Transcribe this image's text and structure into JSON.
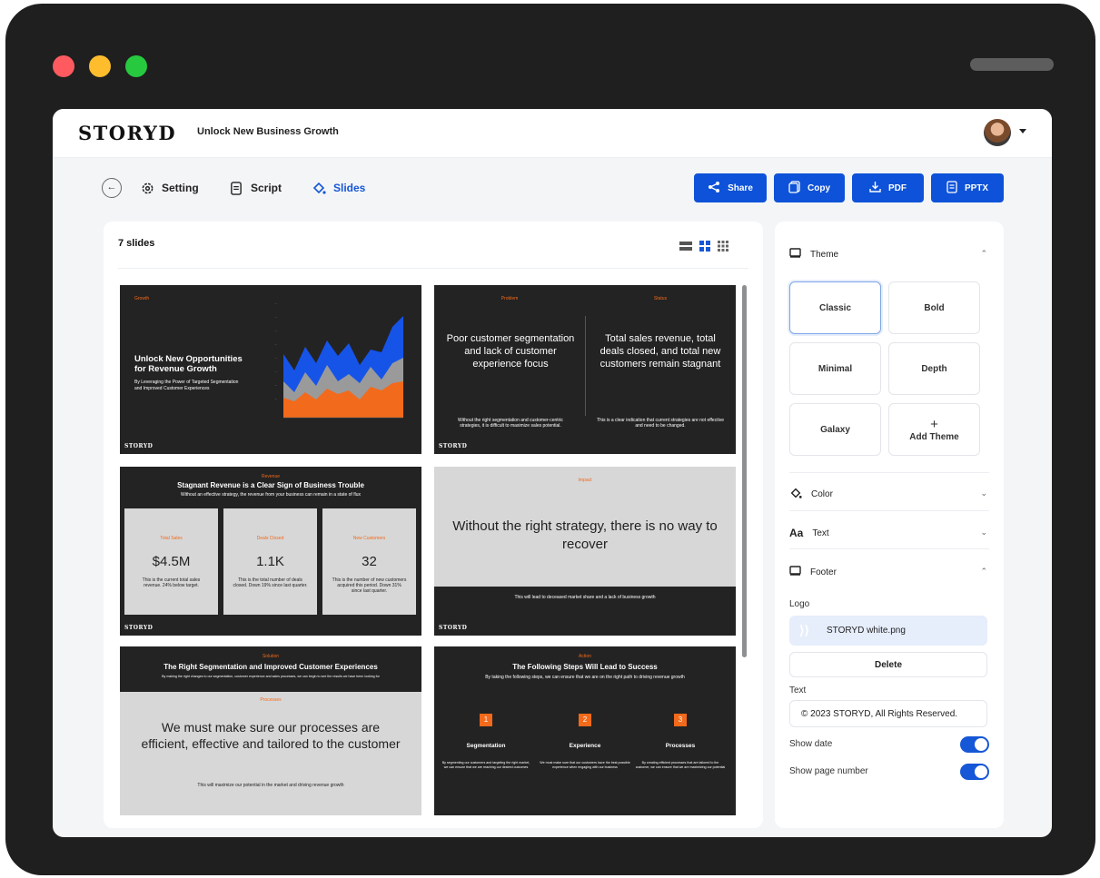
{
  "window": {
    "dot_colors": [
      "#ff5a5f",
      "#ffbd2e",
      "#27c93f"
    ]
  },
  "header": {
    "logo": "STORYD",
    "doc_title": "Unlock New Business Growth"
  },
  "nav": {
    "setting": "Setting",
    "script": "Script",
    "slides": "Slides"
  },
  "actions": {
    "share": "Share",
    "copy": "Copy",
    "pdf": "PDF",
    "pptx": "PPTX"
  },
  "slides_panel": {
    "count_label": "7 slides"
  },
  "slides": {
    "s1": {
      "tag": "Growth",
      "title": "Unlock New Opportunities for Revenue Growth",
      "subtitle": "By Leveraging the Power of Targeted Segmentation and Improved Customer Experiences",
      "footer_logo": "STORYD"
    },
    "s2": {
      "tag_left": "Problem",
      "tag_right": "Status",
      "left_title": "Poor customer segmentation and lack of customer experience focus",
      "right_title": "Total sales revenue, total deals closed, and total new customers remain stagnant",
      "left_text": "Without the right segmentation and customer-centric strategies, it is difficult to maximize sales potential.",
      "right_text": "This is a clear indication that current strategies are not effective and need to be changed.",
      "footer_logo": "STORYD"
    },
    "s3": {
      "tag": "Revenue",
      "title": "Stagnant Revenue is a Clear Sign of Business Trouble",
      "subtitle": "Without an effective strategy, the revenue from your business can remain in a state of flux",
      "footer_logo": "STORYD",
      "cards": [
        {
          "label": "Total Sales",
          "value": "$4.5M",
          "text": "This is the current total sales revenue. 24% below target."
        },
        {
          "label": "Deals Closed",
          "value": "1.1K",
          "text": "This is the total number of deals closed. Down 19% since last quarter."
        },
        {
          "label": "New Customers",
          "value": "32",
          "text": "This is the number of new customers acquired this period. Down 31% since last quarter."
        }
      ]
    },
    "s4": {
      "tag": "Impact",
      "title": "Without the right strategy, there is no way to recover",
      "footer_text": "This will lead to deceased market share and a lack of business growth",
      "footer_logo": "STORYD"
    },
    "s5": {
      "tag": "Solution",
      "title": "The Right Segmentation and Improved Customer Experiences",
      "subtitle": "By making the right changes to our segmentation, customer experience and sales processes, we can begin to see the results we have been looking for",
      "tag2": "Processes",
      "body": "We must make sure our processes are efficient, effective and tailored to the customer",
      "footer_text": "This will maximize our potential in the market and driving revenue growth"
    },
    "s6": {
      "tag": "Action",
      "title": "The Following Steps Will Lead to Success",
      "subtitle": "By taking the following steps, we can ensure that we are on the right path to driving revenue growth",
      "steps": [
        {
          "num": "1",
          "title": "Segmentation",
          "text": "By segmenting our customers and targeting the right market, we can ensure that we are reaching our desired outcomes"
        },
        {
          "num": "2",
          "title": "Experience",
          "text": "We must make sure that our customers have the best possible experience when engaging with our business"
        },
        {
          "num": "3",
          "title": "Processes",
          "text": "By creating efficient processes that are tailored to the customer, we can ensure that we are maximizing our potential"
        }
      ]
    }
  },
  "sidebar": {
    "theme_label": "Theme",
    "themes": [
      "Classic",
      "Bold",
      "Minimal",
      "Depth",
      "Galaxy"
    ],
    "add_theme_icon": "+",
    "add_theme": "Add Theme",
    "color_label": "Color",
    "text_label": "Text",
    "text_icon": "Aa",
    "footer_label": "Footer",
    "logo_label": "Logo",
    "logo_file": "STORYD white.png",
    "delete": "Delete",
    "text_field_label": "Text",
    "footer_text": "© 2023 STORYD, All Rights Reserved.",
    "show_date": "Show date",
    "show_page_number": "Show page number"
  }
}
